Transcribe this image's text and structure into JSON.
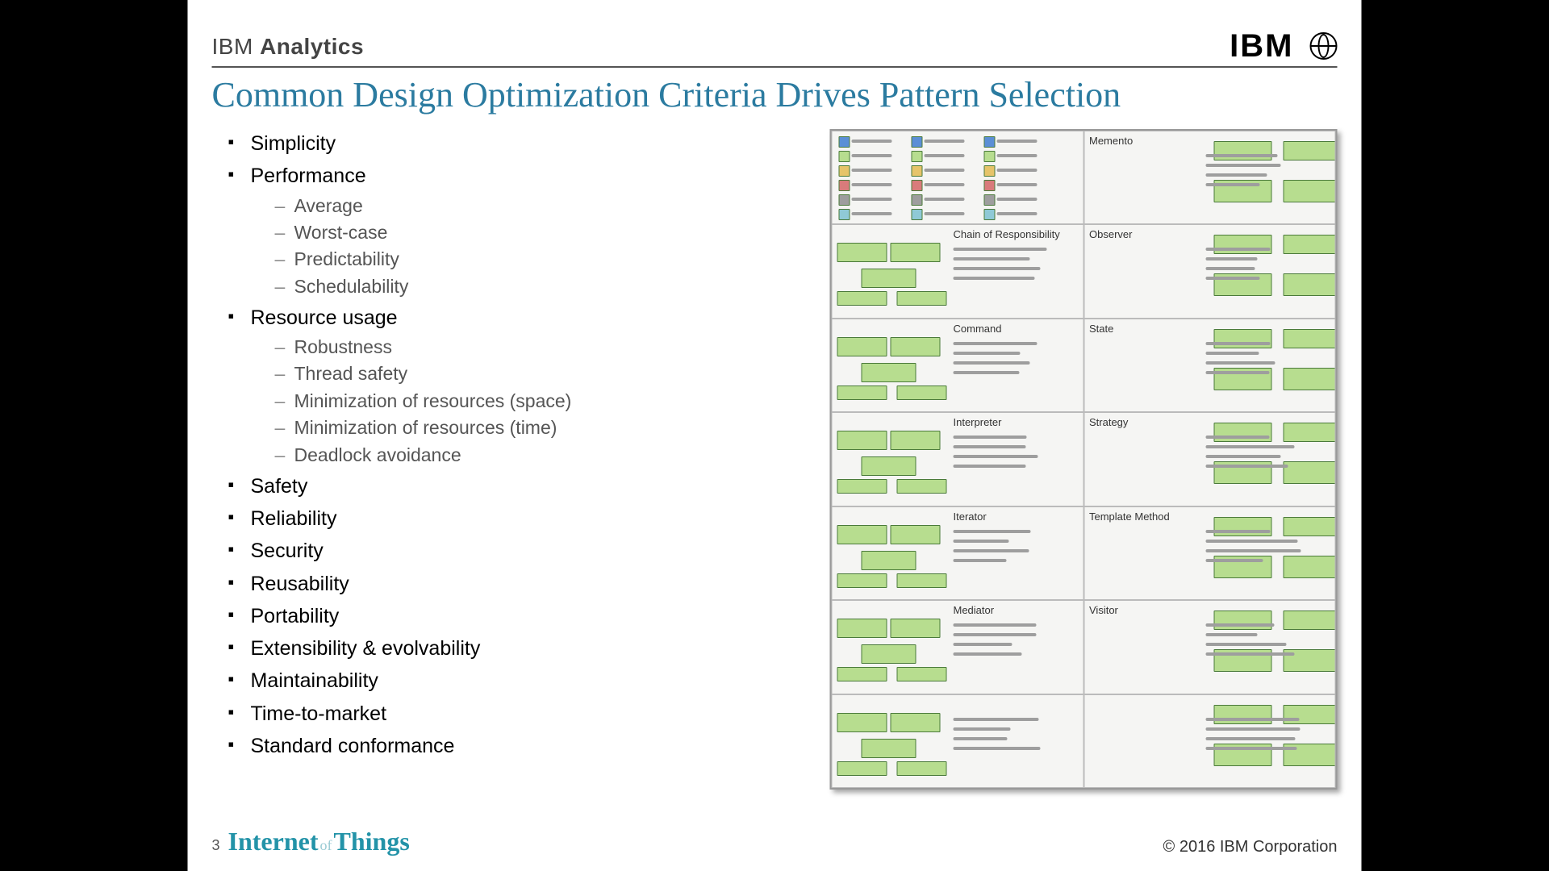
{
  "header": {
    "brand_light": "IBM ",
    "brand_bold": "Analytics",
    "logo_text": "IBM"
  },
  "title": "Common Design Optimization Criteria Drives Pattern Selection",
  "bullets": [
    {
      "label": "Simplicity"
    },
    {
      "label": "Performance",
      "children": [
        "Average",
        "Worst-case",
        "Predictability",
        "Schedulability"
      ]
    },
    {
      "label": "Resource usage",
      "children": [
        "Robustness",
        "Thread safety",
        "Minimization of resources (space)",
        "Minimization of resources (time)",
        "Deadlock avoidance"
      ]
    },
    {
      "label": "Safety"
    },
    {
      "label": "Reliability"
    },
    {
      "label": "Security"
    },
    {
      "label": "Reusability"
    },
    {
      "label": "Portability"
    },
    {
      "label": "Extensibility & evolvability"
    },
    {
      "label": "Maintainability"
    },
    {
      "label": "Time-to-market"
    },
    {
      "label": "Standard conformance"
    }
  ],
  "patterns": {
    "row0_left": "",
    "row0_right": "Memento",
    "rows": [
      [
        "Chain of Responsibility",
        "Observer"
      ],
      [
        "Command",
        "State"
      ],
      [
        "Interpreter",
        "Strategy"
      ],
      [
        "Iterator",
        "Template Method"
      ],
      [
        "Mediator",
        "Visitor"
      ]
    ]
  },
  "footer": {
    "page": "3",
    "iot_a": "Internet",
    "iot_of": "of",
    "iot_b": "Things",
    "copyright": "© 2016 IBM Corporation"
  }
}
